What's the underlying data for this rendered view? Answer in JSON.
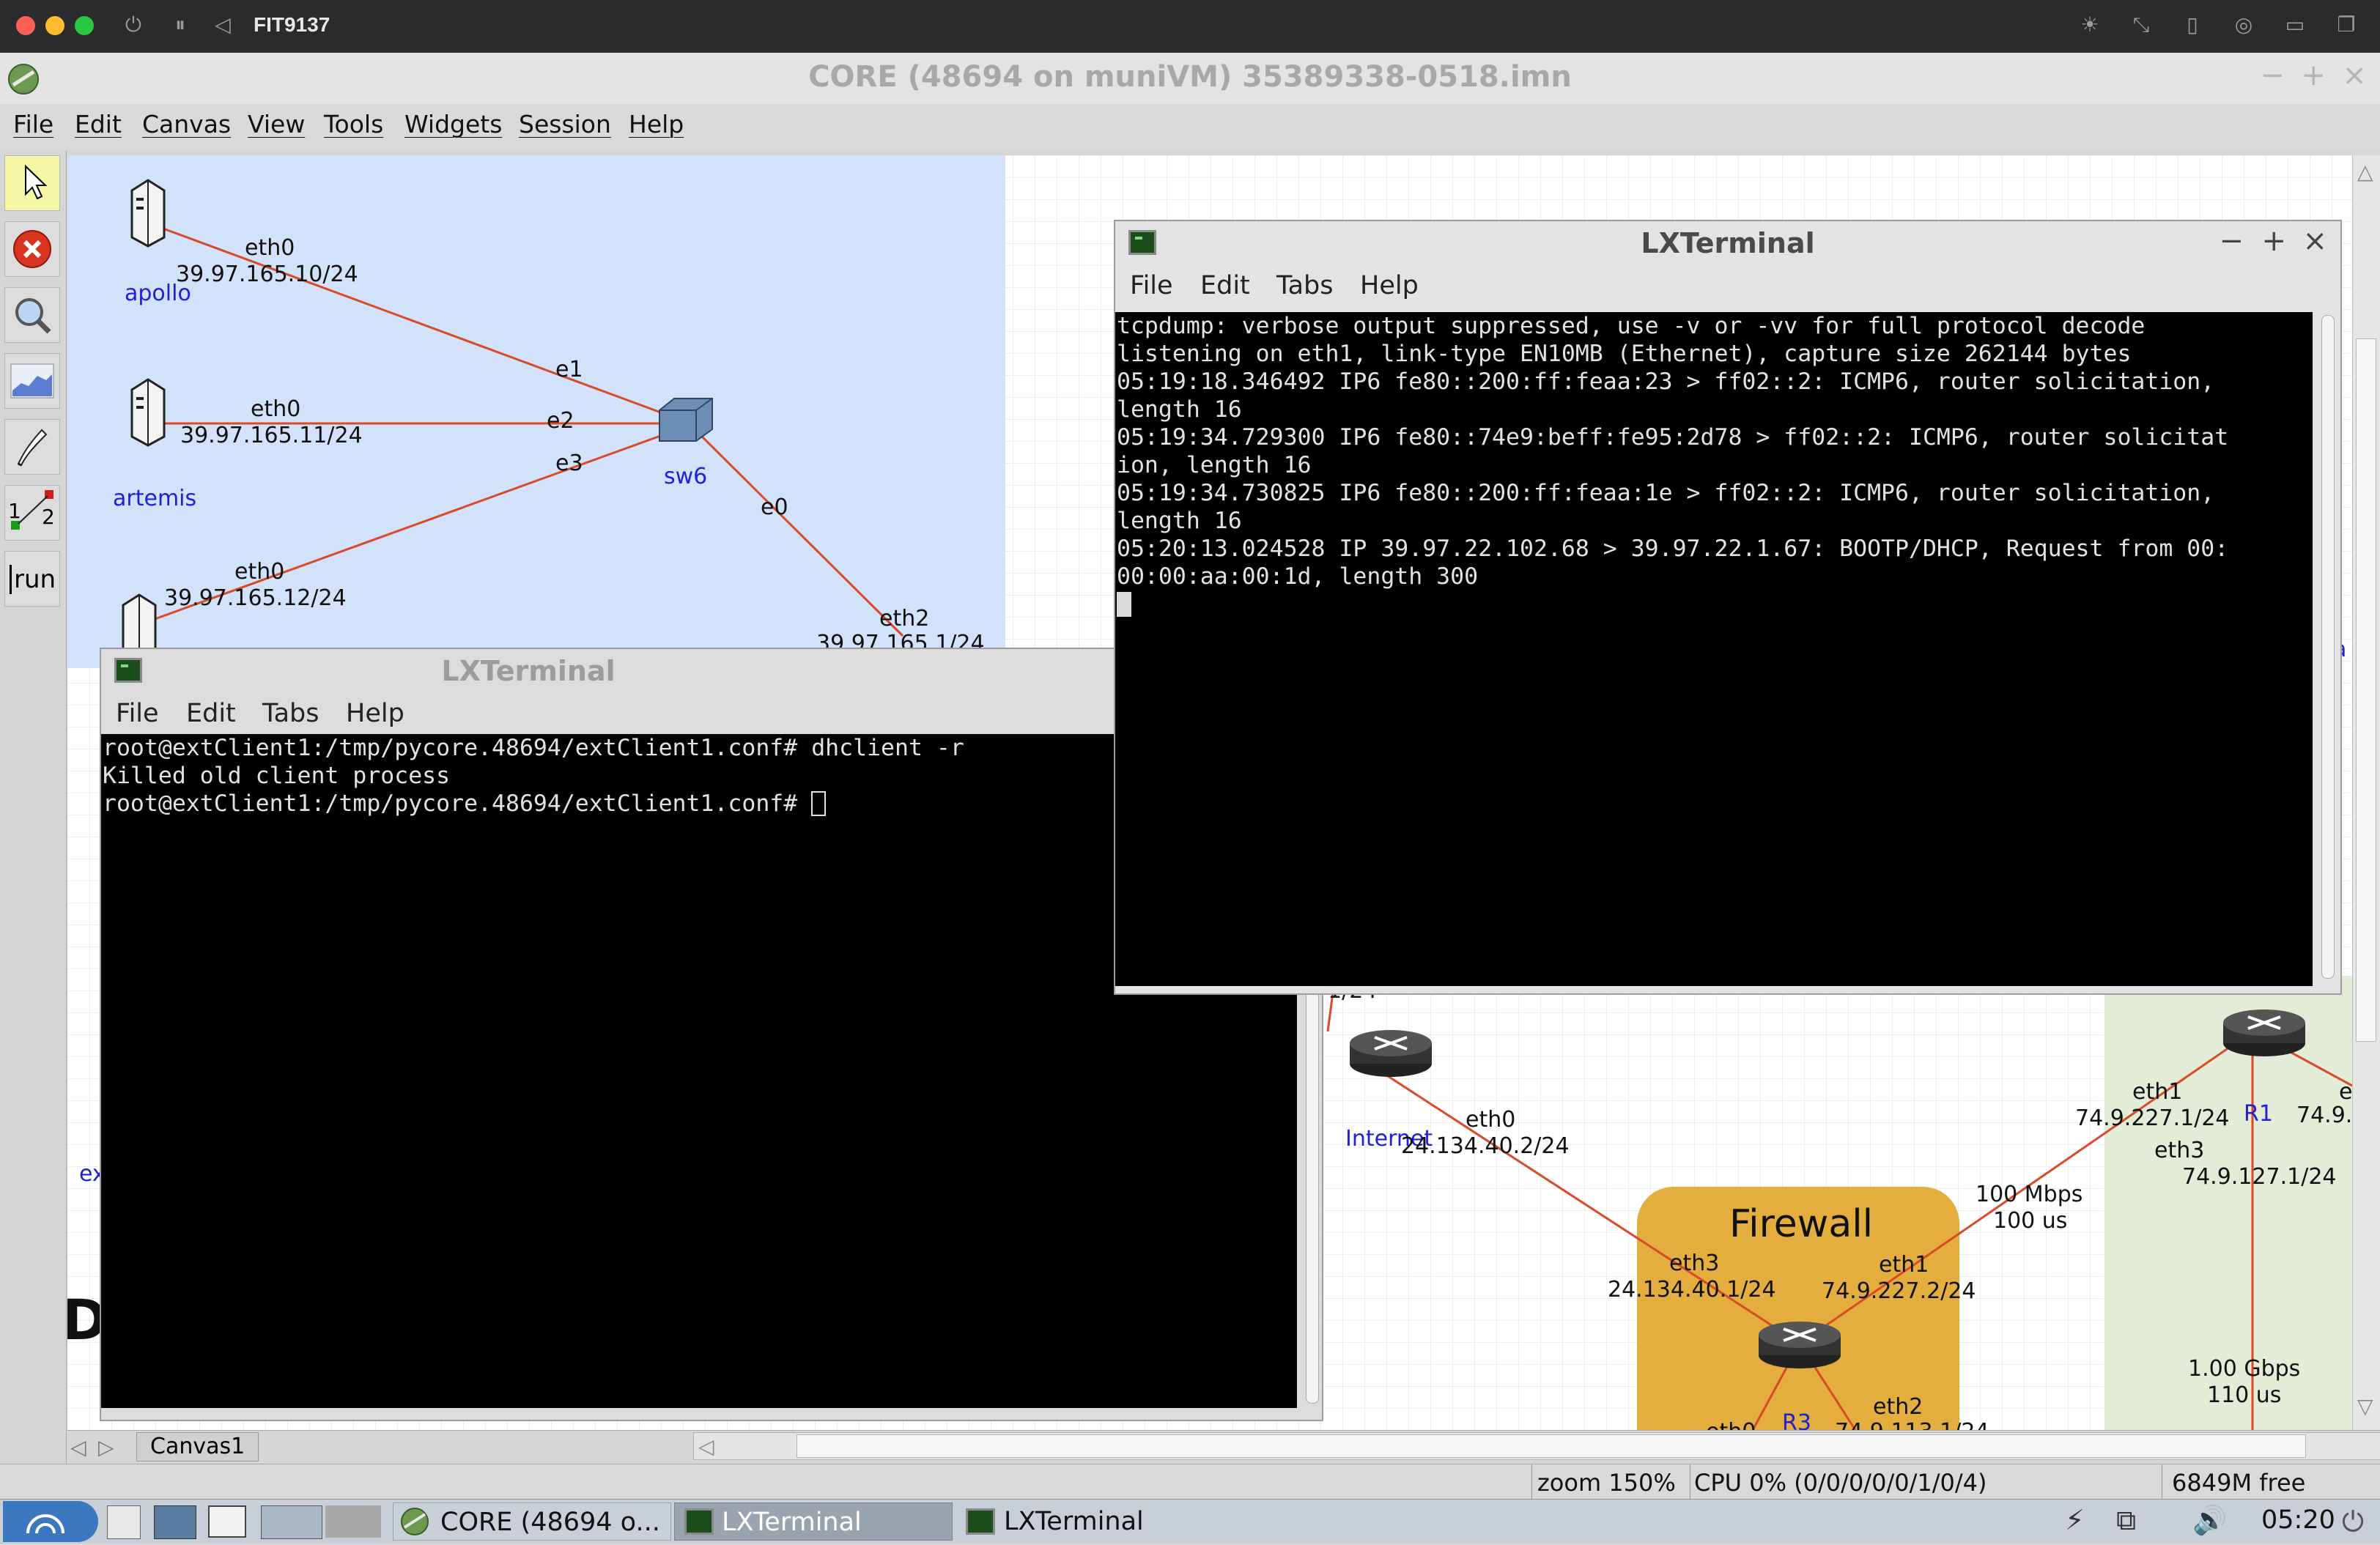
{
  "mac": {
    "title": "FIT9137"
  },
  "app": {
    "title": "CORE (48694 on muniVM) 35389338-0518.imn"
  },
  "menubar": [
    "File",
    "Edit",
    "Canvas",
    "View",
    "Tools",
    "Widgets",
    "Session",
    "Help"
  ],
  "toolbar": {
    "run_label": "run",
    "link_nums": [
      "1",
      "2"
    ]
  },
  "canvas": {
    "nodes": {
      "apollo": "apollo",
      "artemis": "artemis",
      "sw6": "sw6",
      "internet": "Internet",
      "r1": "R1",
      "r3": "R3",
      "firewall": "Firewall",
      "partial_left": "ex",
      "partial_big": "D",
      "partial_right": "a"
    },
    "labels": {
      "apollo_if": "eth0",
      "apollo_ip": "39.97.165.10/24",
      "artemis_if": "eth0",
      "artemis_ip": "39.97.165.11/24",
      "third_if": "eth0",
      "third_ip": "39.97.165.12/24",
      "e1": "e1",
      "e2": "e2",
      "e3": "e3",
      "e0": "e0",
      "rt_eth2": "eth2",
      "rt_eth2_ip": "39.97.165.1/24",
      "inet_frag": "1/24",
      "inet_eth0": "eth0",
      "inet_ip": "24.134.40.2/24",
      "fw_eth3": "eth3",
      "fw_eth3_ip": "24.134.40.1/24",
      "fw_eth1": "eth1",
      "fw_eth1_ip": "74.9.227.2/24",
      "fw_eth2": "eth2",
      "fw_eth0_frag": "eth0",
      "fw_eth2_ip_frag": "74.9.113.1/24",
      "r1_eth1": "eth1",
      "r1_eth1_ip": "74.9.227.1/24",
      "r1_eth3": "eth3",
      "r1_eth3_ip": "74.9.127.1/24",
      "r1_right_frag": "74.9.",
      "r1_e_frag": "e",
      "link1_bw": "100 Mbps",
      "link1_delay": "100 us",
      "link2_bw": "1.00 Gbps",
      "link2_delay": "110 us"
    }
  },
  "tabs": {
    "canvas1": "Canvas1"
  },
  "status": {
    "zoom": "zoom 150%",
    "cpu": "CPU 0% (0/0/0/0/0/1/0/4)",
    "mem": "6849M free"
  },
  "terminal_left": {
    "title": "LXTerminal",
    "menus": [
      "File",
      "Edit",
      "Tabs",
      "Help"
    ],
    "lines": [
      "root@extClient1:/tmp/pycore.48694/extClient1.conf# dhclient -r",
      "Killed old client process",
      "root@extClient1:/tmp/pycore.48694/extClient1.conf# "
    ]
  },
  "terminal_right": {
    "title": "LXTerminal",
    "menus": [
      "File",
      "Edit",
      "Tabs",
      "Help"
    ],
    "lines": [
      "tcpdump: verbose output suppressed, use -v or -vv for full protocol decode",
      "listening on eth1, link-type EN10MB (Ethernet), capture size 262144 bytes",
      "05:19:18.346492 IP6 fe80::200:ff:feaa:23 > ff02::2: ICMP6, router solicitation,",
      "length 16",
      "05:19:34.729300 IP6 fe80::74e9:beff:fe95:2d78 > ff02::2: ICMP6, router solicitat",
      "ion, length 16",
      "05:19:34.730825 IP6 fe80::200:ff:feaa:1e > ff02::2: ICMP6, router solicitation,",
      "length 16",
      "05:20:13.024528 IP 39.97.22.102.68 > 39.97.22.1.67: BOOTP/DHCP, Request from 00:",
      "00:00:aa:00:1d, length 300"
    ]
  },
  "taskbar": {
    "core": "CORE (48694 o...",
    "term1": "LXTerminal",
    "term2": "LXTerminal",
    "clock": "05:20"
  },
  "colors": {
    "link": "#d84a28",
    "lan_bg": "#d3e2fb",
    "firewall_bg": "#e3ae3e",
    "green_zone": "#e3ecd6",
    "node_label": "#2020d8"
  },
  "icons": [
    "select-icon",
    "stop-icon",
    "zoom-icon",
    "plot-icon",
    "marker-icon",
    "twonode-icon",
    "run-icon",
    "router-icon",
    "host-icon",
    "switch-icon"
  ]
}
